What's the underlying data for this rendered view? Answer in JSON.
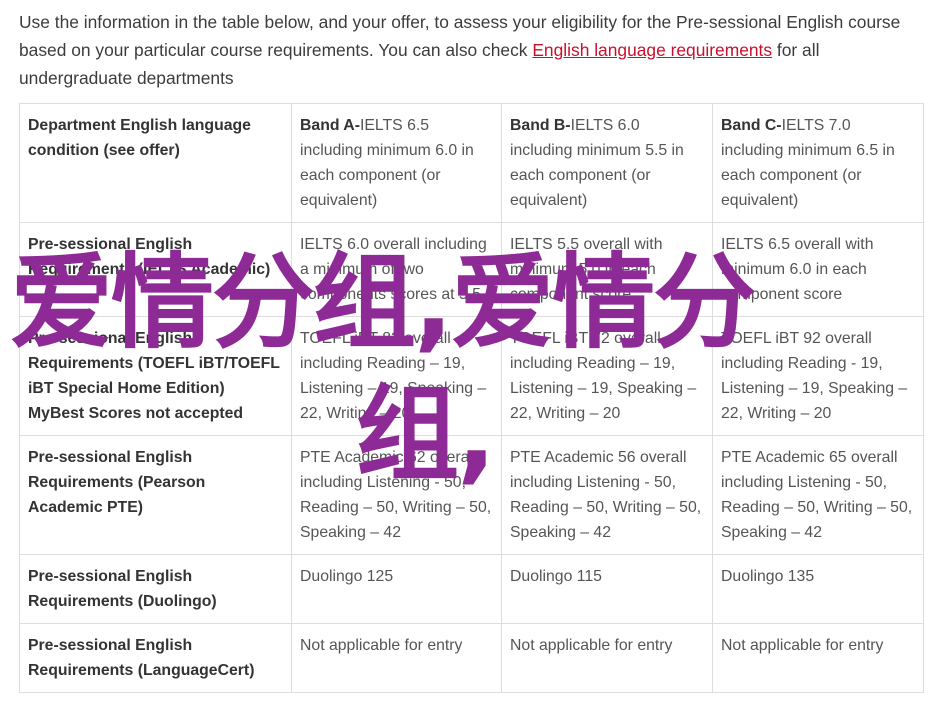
{
  "intro": {
    "text_before_link": "Use the information in the table below, and your offer, to assess your eligibility for the Pre-sessional English course based on your particular course requirements. You can also check ",
    "link_text": "English language requirements",
    "text_after_link": " for all undergraduate departments"
  },
  "table": {
    "header": {
      "col1": "Department English language condition (see offer)",
      "bands": [
        {
          "bold": "Band A-",
          "rest": "IELTS 6.5 including minimum 6.0 in each component (or equivalent)"
        },
        {
          "bold": "Band B-",
          "rest": "IELTS 6.0 including minimum 5.5 in each component (or equivalent)"
        },
        {
          "bold": "Band C-",
          "rest": "IELTS 7.0 including minimum 6.5 in each component (or equivalent)"
        }
      ]
    },
    "rows": [
      {
        "label": "Pre-sessional English Requirements (IELTS Academic)",
        "cells": [
          "IELTS 6.0 overall including a minimum of two components scores at 5.5",
          "IELTS 5.5 overall with minimum 5.0 in each component score",
          "IELTS 6.5 overall with minimum 6.0 in each component score"
        ]
      },
      {
        "label": "Pre-sessional English Requirements (TOEFL iBT/TOEFL iBT Special Home Edition) MyBest Scores not accepted",
        "cells": [
          "TOEFL iBT 82 overall including Reading – 19, Listening – 19, Speaking – 22, Writing – 20",
          "TOEFL iBT 72 overall including Reading – 19, Listening – 19, Speaking – 22, Writing – 20",
          "TOEFL iBT 92 overall including Reading - 19, Listening – 19, Speaking – 22, Writing – 20"
        ]
      },
      {
        "label": "Pre-sessional English Requirements (Pearson Academic PTE)",
        "cells": [
          "PTE Academic 62 overall including Listening - 50, Reading – 50, Writing – 50, Speaking – 42",
          "PTE Academic 56 overall including Listening - 50, Reading – 50, Writing – 50, Speaking – 42",
          "PTE Academic 65 overall including Listening - 50, Reading – 50, Writing – 50, Speaking – 42"
        ]
      },
      {
        "label": "Pre-sessional English Requirements (Duolingo)",
        "cells": [
          "Duolingo 125",
          "Duolingo 115",
          "Duolingo 135"
        ]
      },
      {
        "label": "Pre-sessional English Requirements (LanguageCert)",
        "cells": [
          "Not applicable for entry",
          "Not applicable for entry",
          "Not applicable for entry"
        ]
      }
    ]
  },
  "watermark": {
    "line1": "爱情分组,爱情分",
    "line2": "组,"
  },
  "colors": {
    "link": "#c8102e",
    "watermark": "#8e2a96",
    "border": "#dedede"
  }
}
